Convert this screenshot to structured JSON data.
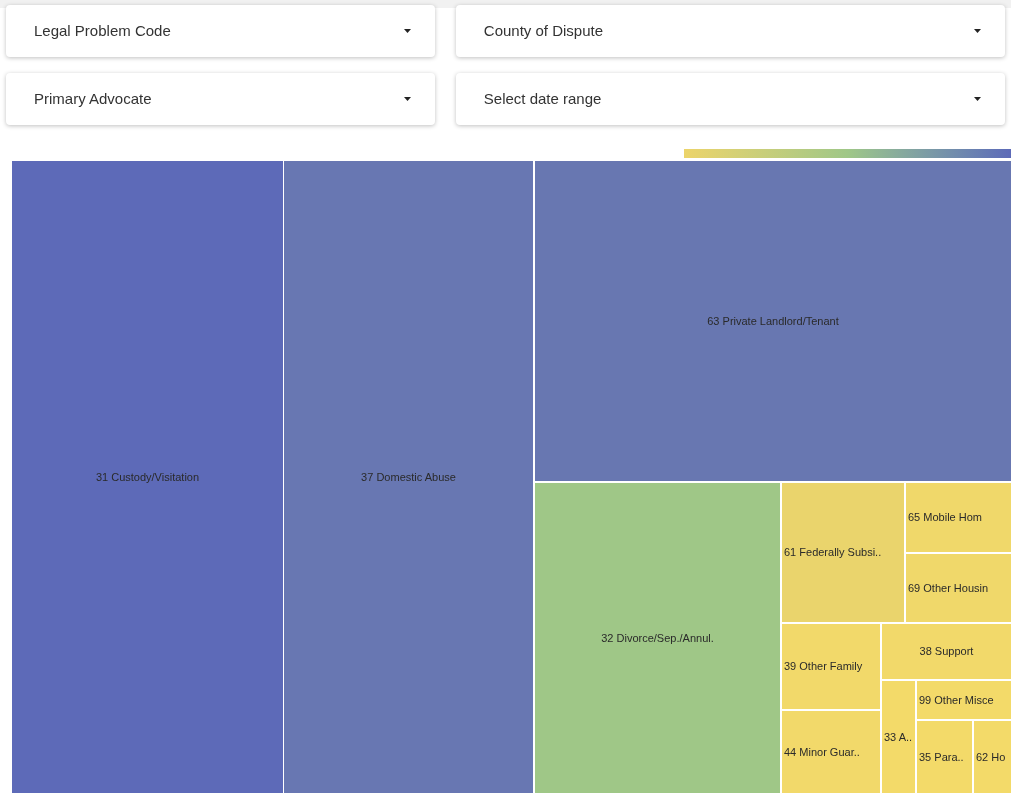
{
  "filters": [
    {
      "label": "Legal Problem Code"
    },
    {
      "label": "County of Dispute"
    },
    {
      "label": "Primary Advocate"
    },
    {
      "label": "Select date range"
    }
  ],
  "treemap": {
    "cells": [
      {
        "label": "31 Custody/Visitation",
        "color": "#5d6ab8"
      },
      {
        "label": "37 Domestic Abuse",
        "color": "#6877b2"
      },
      {
        "label": "63 Private Landlord/Tenant",
        "color": "#6877b1"
      },
      {
        "label": "32 Divorce/Sep./Annul.",
        "color": "#9fc787"
      },
      {
        "label": "61 Federally Subsi..",
        "color": "#ead46c"
      },
      {
        "label": "65 Mobile Hom",
        "color": "#f0d86a"
      },
      {
        "label": "69 Other Housin",
        "color": "#f0d86a"
      },
      {
        "label": "39 Other Family",
        "color": "#f2d96a"
      },
      {
        "label": "38 Support",
        "color": "#f2d96a"
      },
      {
        "label": "99 Other Misce",
        "color": "#f3da69"
      },
      {
        "label": "33 A..",
        "color": "#f3da69"
      },
      {
        "label": "44 Minor Guar..",
        "color": "#f2d96a"
      },
      {
        "label": "35 Para..",
        "color": "#f3da69"
      },
      {
        "label": "62 Ho",
        "color": "#f3da69"
      }
    ]
  }
}
